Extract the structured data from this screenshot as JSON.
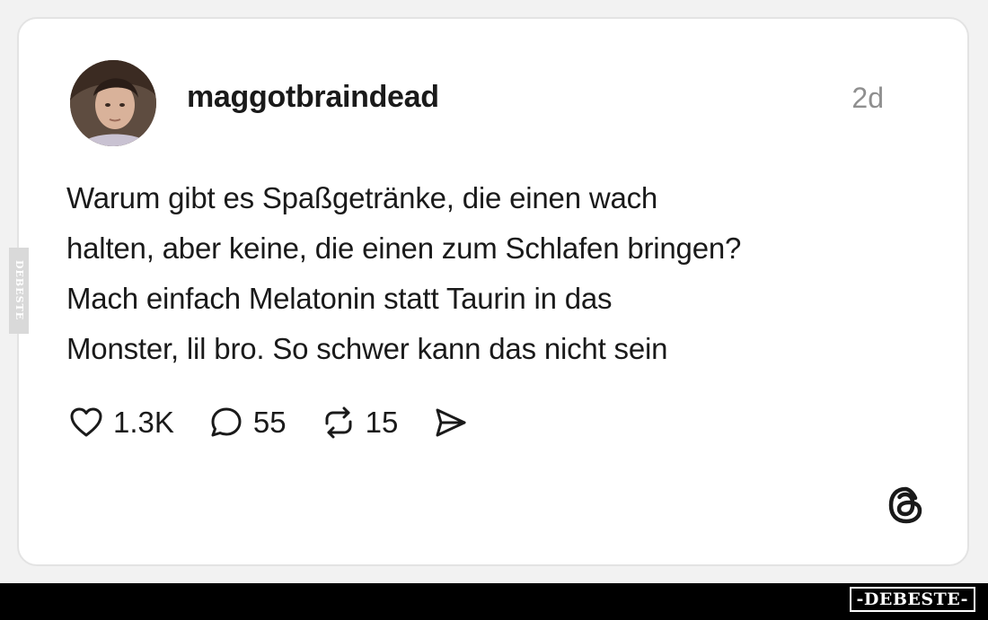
{
  "post": {
    "username": "maggotbraindead",
    "timestamp": "2d",
    "text": "Warum gibt es Spaßgetränke, die einen wach\nhalten, aber keine, die einen zum Schlafen bringen?\nMach einfach Melatonin statt Taurin in das\nMonster, lil bro. So schwer kann das nicht sein",
    "actions": {
      "likes": "1.3K",
      "replies": "55",
      "reposts": "15"
    }
  },
  "icons": {
    "like": "heart-icon",
    "reply": "speech-bubble-icon",
    "repost": "repost-arrows-icon",
    "share": "send-icon",
    "brand": "threads-logo-icon"
  },
  "watermark": {
    "side": "DEBESTE",
    "footer": "-DEBESTE-"
  },
  "colors": {
    "text": "#1a1a1a",
    "muted": "#8f8f8f",
    "card_bg": "#ffffff",
    "page_bg": "#f2f2f2",
    "footer_bg": "#000000"
  }
}
